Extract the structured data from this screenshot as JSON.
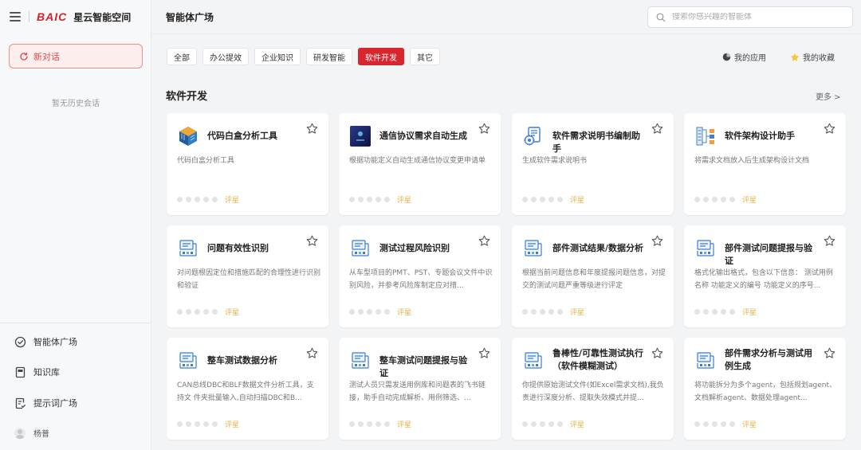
{
  "sidebar": {
    "logo": "BAIC",
    "brand": "星云智能空间",
    "new_chat": "新对话",
    "no_history": "暂无历史会话",
    "nav": [
      {
        "label": "智能体广场",
        "icon": "agent-plaza-icon"
      },
      {
        "label": "知识库",
        "icon": "knowledge-base-icon"
      },
      {
        "label": "提示词广场",
        "icon": "prompt-plaza-icon"
      }
    ],
    "user": "杨普"
  },
  "header": {
    "title": "智能体广场",
    "search_placeholder": "搜索你感兴趣的智能体"
  },
  "filters": [
    "全部",
    "办公提效",
    "企业知识",
    "研发智能",
    "软件开发",
    "其它"
  ],
  "active_filter": "软件开发",
  "links": {
    "my_apps": "我的应用",
    "my_favorites": "我的收藏"
  },
  "section": {
    "title": "软件开发",
    "more": "更多 >"
  },
  "rating_label": "评星",
  "colors": {
    "accent": "#d9252d",
    "rating": "#e0b24a"
  },
  "cards": [
    {
      "title": "代码白盒分析工具",
      "desc": "代码白盒分析工具",
      "icon": "cube-icon"
    },
    {
      "title": "通信协议需求自动生成",
      "desc": "根据功能定义自动生成通信协议变更申请单",
      "icon": "dark-app-icon"
    },
    {
      "title": "软件需求说明书编制助手",
      "desc": "生成软件需求说明书",
      "icon": "gear-doc-icon"
    },
    {
      "title": "软件架构设计助手",
      "desc": "将需求文档放入后生成架构设计文档",
      "icon": "architecture-icon"
    },
    {
      "title": "问题有效性识别",
      "desc": "对问题根因定位和措施匹配的合理性进行识别和验证",
      "icon": "data-icon"
    },
    {
      "title": "测试过程风险识别",
      "desc": "从车型项目的PMT、PST、专题会议文件中识别风险，并参考风险库制定应对措...",
      "icon": "data-icon"
    },
    {
      "title": "部件测试结果/数据分析",
      "desc": "根据当前问题信息和年度提报问题信息，对提交的测试问题严重等级进行评定",
      "icon": "data-icon"
    },
    {
      "title": "部件测试问题提报与验证",
      "desc": "格式化输出格式，包含以下信息：  测试用例名称 功能定义的编号 功能定义的序号...",
      "icon": "data-icon"
    },
    {
      "title": "整车测试数据分析",
      "desc": "CAN总线DBC和BLF数据文件分析工具，支持文 件夹批量输入,自动扫描DBC和B...",
      "icon": "data-icon"
    },
    {
      "title": "整车测试问题提报与验证",
      "desc": "测试人员只需发送用例库和问题表的飞书链接，助手自动完成解析、用例筛选、...",
      "icon": "data-icon"
    },
    {
      "title": "鲁棒性/可靠性测试执行（软件模糊测试）",
      "desc": "你提供原始测试文件(如Excel需求文档),我负责进行深度分析、提取失效模式并提...",
      "icon": "data-icon"
    },
    {
      "title": "部件需求分析与测试用例生成",
      "desc": "将功能拆分为多个agent，包括规划agent、文档解析agent、数据处理agent...",
      "icon": "data-icon"
    }
  ]
}
